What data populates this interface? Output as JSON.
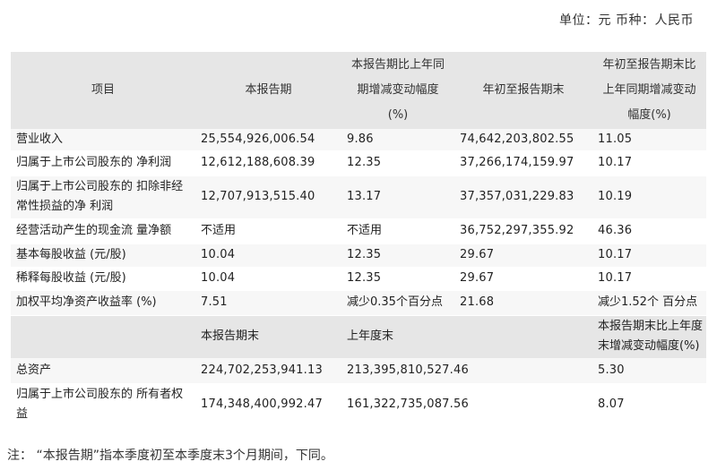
{
  "unit_label": "单位：元 币种：人民币",
  "header": {
    "col1": "项目",
    "col2": "本报告期",
    "col3": [
      "本报告期比上年同",
      "期增减变动幅度",
      "(%)"
    ],
    "col4": "年初至报告期末",
    "col5": [
      "年初至报告期末比",
      "上年同期增减变动",
      "幅度(%)"
    ]
  },
  "rows": [
    {
      "item": "营业收入",
      "current": "25,554,926,006.54",
      "change": "9.86",
      "ytd": "74,642,203,802.55",
      "ytd_change": "11.05"
    },
    {
      "item": "归属于上市公司股东的 净利润",
      "current": "12,612,188,608.39",
      "change": "12.35",
      "ytd": "37,266,174,159.97",
      "ytd_change": "10.17"
    },
    {
      "item": "归属于上市公司股东的 扣除非经常性损益的净 利润",
      "item_line1": "归属于上市公司股东的 扣除非经",
      "item_line2": "常性损益的净 利润",
      "current": "12,707,913,515.40",
      "change": "13.17",
      "ytd": "37,357,031,229.83",
      "ytd_change": "10.19"
    },
    {
      "item": "经营活动产生的现金流 量净额",
      "current": "不适用",
      "change": "不适用",
      "ytd": "36,752,297,355.92",
      "ytd_change": "46.36"
    },
    {
      "item": "基本每股收益 (元/股)",
      "current": "10.04",
      "change": "12.35",
      "ytd": "29.67",
      "ytd_change": "10.17"
    },
    {
      "item": "稀释每股收益 (元/股)",
      "current": "10.04",
      "change": "12.35",
      "ytd": "29.67",
      "ytd_change": "10.17"
    },
    {
      "item": "加权平均净资产收益率 (%)",
      "current": "7.51",
      "change": "减少0.35个百分点",
      "ytd": "21.68",
      "ytd_change": "减少1.52个 百分点"
    }
  ],
  "subheader": {
    "col2": "本报告期末",
    "col3": "上年度末",
    "col5": [
      "本报告期末比上年度",
      "末增减变动幅度(%)"
    ]
  },
  "rows2": [
    {
      "item": "总资产",
      "current": "224,702,253,941.13",
      "prev": "213,395,810,527.46",
      "change": "5.30"
    },
    {
      "item_line1": "归属于上市公司股东的 所有者权",
      "item_line2": "益",
      "current": "174,348,400,992.47",
      "prev": "161,322,735,087.56",
      "change": "8.07"
    }
  ],
  "note": "注：  “本报告期”指本季度初至本季度末3个月期间，下同。"
}
